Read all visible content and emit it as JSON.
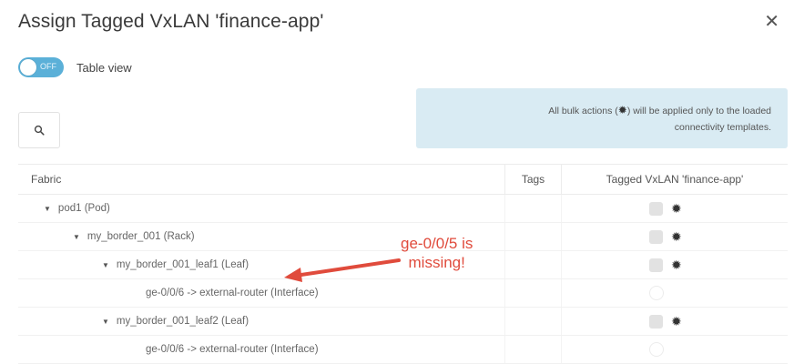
{
  "dialog": {
    "title": "Assign Tagged VxLAN 'finance-app'",
    "close_icon": "close-icon"
  },
  "toggle": {
    "state_text": "OFF",
    "label": "Table view"
  },
  "info": {
    "line1_before": "All bulk actions (",
    "line1_after": ") will be applied only to the loaded",
    "line2": "connectivity templates."
  },
  "table": {
    "headers": {
      "fabric": "Fabric",
      "tags": "Tags",
      "tagged": "Tagged VxLAN 'finance-app'"
    },
    "rows": [
      {
        "label": "pod1 (Pod)"
      },
      {
        "label": "my_border_001 (Rack)"
      },
      {
        "label": "my_border_001_leaf1 (Leaf)"
      },
      {
        "label": "ge-0/0/6 -> external-router (Interface)"
      },
      {
        "label": "my_border_001_leaf2 (Leaf)"
      },
      {
        "label": "ge-0/0/6 -> external-router (Interface)"
      }
    ]
  },
  "annotation": {
    "line1": "ge-0/0/5 is",
    "line2": "missing!",
    "color": "#e04b3c"
  }
}
